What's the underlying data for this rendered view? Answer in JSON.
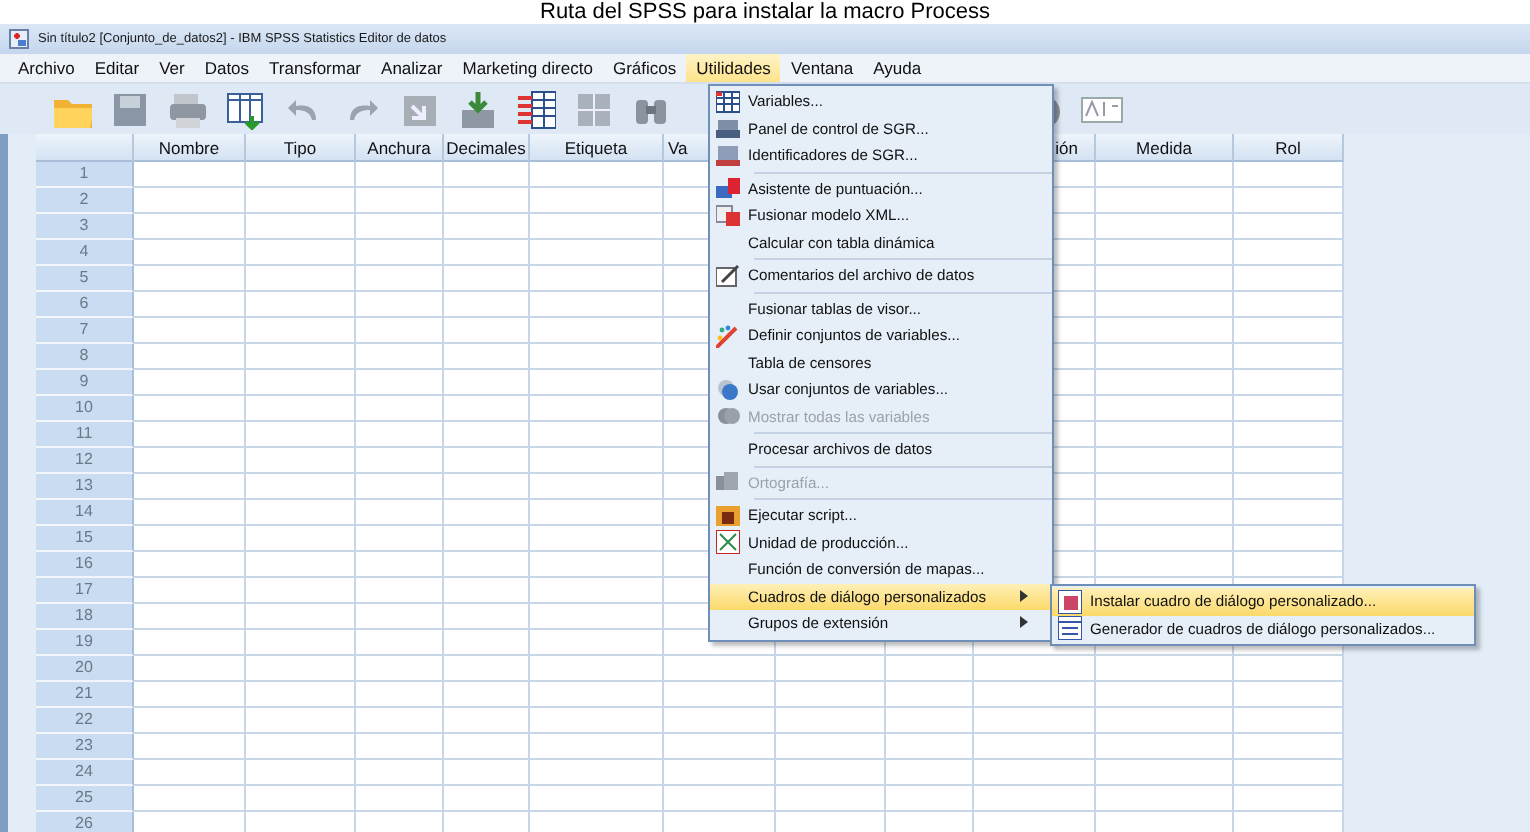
{
  "caption": "Ruta del SPSS para instalar la macro Process",
  "window": {
    "title": "Sin título2 [Conjunto_de_datos2] - IBM SPSS Statistics Editor de datos"
  },
  "menubar": [
    {
      "label": "Archivo",
      "selected": false
    },
    {
      "label": "Editar",
      "selected": false
    },
    {
      "label": "Ver",
      "selected": false
    },
    {
      "label": "Datos",
      "selected": false
    },
    {
      "label": "Transformar",
      "selected": false
    },
    {
      "label": "Analizar",
      "selected": false
    },
    {
      "label": "Marketing directo",
      "selected": false
    },
    {
      "label": "Gráficos",
      "selected": false
    },
    {
      "label": "Utilidades",
      "selected": true
    },
    {
      "label": "Ventana",
      "selected": false
    },
    {
      "label": "Ayuda",
      "selected": false
    }
  ],
  "table": {
    "columns": [
      {
        "label": "Nombre"
      },
      {
        "label": "Tipo"
      },
      {
        "label": "Anchura"
      },
      {
        "label": "Decimales"
      },
      {
        "label": "Etiqueta"
      },
      {
        "label": "Va"
      },
      {},
      {},
      {
        "label": "ión"
      },
      {
        "label": "Medida"
      },
      {
        "label": "Rol"
      }
    ],
    "row_headers": [
      "1",
      "2",
      "3",
      "4",
      "5",
      "6",
      "7",
      "8",
      "9",
      "10",
      "11",
      "12",
      "13",
      "14",
      "15",
      "16",
      "17",
      "18",
      "19",
      "20",
      "21",
      "22",
      "23",
      "24",
      "25",
      "26"
    ]
  },
  "menu": [
    {
      "label": "Variables...",
      "disabled": false,
      "selected": false,
      "submenu": false,
      "separator_after": false
    },
    {
      "label": "Panel de control de SGR...",
      "disabled": false,
      "selected": false,
      "submenu": false,
      "separator_after": false
    },
    {
      "label": "Identificadores de SGR...",
      "disabled": false,
      "selected": false,
      "submenu": false,
      "separator_after": true
    },
    {
      "label": "Asistente de puntuación...",
      "disabled": false,
      "selected": false,
      "submenu": false,
      "separator_after": false
    },
    {
      "label": "Fusionar modelo XML...",
      "disabled": false,
      "selected": false,
      "submenu": false,
      "separator_after": false
    },
    {
      "label": "Calcular con tabla dinámica",
      "disabled": false,
      "selected": false,
      "submenu": false,
      "separator_after": true
    },
    {
      "label": "Comentarios del archivo de datos",
      "disabled": false,
      "selected": false,
      "submenu": false,
      "separator_after": true
    },
    {
      "label": "Fusionar tablas de visor...",
      "disabled": false,
      "selected": false,
      "submenu": false,
      "separator_after": false
    },
    {
      "label": "Definir conjuntos de variables...",
      "disabled": false,
      "selected": false,
      "submenu": false,
      "separator_after": false
    },
    {
      "label": "Tabla de censores",
      "disabled": false,
      "selected": false,
      "submenu": false,
      "separator_after": false
    },
    {
      "label": "Usar conjuntos de variables...",
      "disabled": false,
      "selected": false,
      "submenu": false,
      "separator_after": false
    },
    {
      "label": "Mostrar todas las variables",
      "disabled": true,
      "selected": false,
      "submenu": false,
      "separator_after": true
    },
    {
      "label": "Procesar archivos de datos",
      "disabled": false,
      "selected": false,
      "submenu": false,
      "separator_after": true
    },
    {
      "label": "Ortografía...",
      "disabled": true,
      "selected": false,
      "submenu": false,
      "separator_after": true
    },
    {
      "label": "Ejecutar script...",
      "disabled": false,
      "selected": false,
      "submenu": false,
      "separator_after": false
    },
    {
      "label": "Unidad de producción...",
      "disabled": false,
      "selected": false,
      "submenu": false,
      "separator_after": false
    },
    {
      "label": "Función de conversión de mapas...",
      "disabled": false,
      "selected": false,
      "submenu": false,
      "separator_after": false
    },
    {
      "label": "Cuadros de diálogo personalizados",
      "disabled": false,
      "selected": true,
      "submenu": true,
      "separator_after": false
    },
    {
      "label": "Grupos de extensión",
      "disabled": false,
      "selected": false,
      "submenu": true,
      "separator_after": false
    }
  ],
  "submenu": [
    {
      "label": "Instalar cuadro de diálogo personalizado...",
      "selected": true
    },
    {
      "label": "Generador de cuadros de diálogo personalizados...",
      "selected": false
    }
  ]
}
